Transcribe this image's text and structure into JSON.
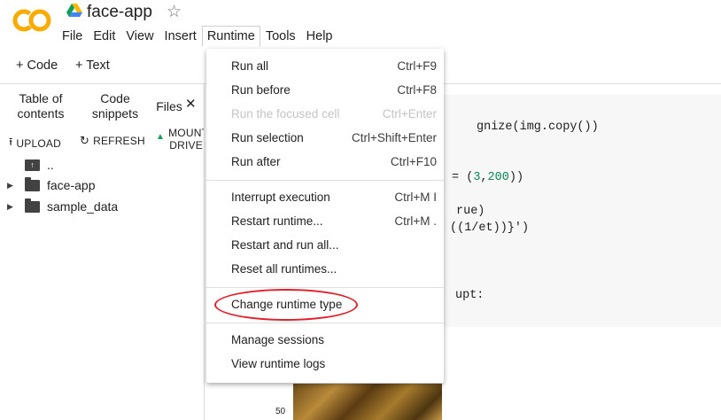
{
  "app": {
    "logo_text": "CO",
    "title": "face-app",
    "brand_color": "#f9ab00"
  },
  "menu": [
    "File",
    "Edit",
    "View",
    "Insert",
    "Runtime",
    "Tools",
    "Help"
  ],
  "toolbar": {
    "code_label": "+ Code",
    "text_label": "+ Text"
  },
  "sidebar": {
    "tabs": [
      "Table of contents",
      "Code snippets",
      "Files"
    ],
    "close_symbol": "✕",
    "actions": {
      "upload": "UPLOAD",
      "refresh": "REFRESH",
      "mount": "MOUNT DRIVE"
    },
    "tree": [
      {
        "name": ".."
      },
      {
        "name": "face-app"
      },
      {
        "name": "sample_data"
      }
    ]
  },
  "code_lines": [
    {
      "text": "gnize(img.copy())"
    },
    {
      "text": "= (3,200))"
    },
    {
      "text": "rue)"
    },
    {
      "text": "((1/et))}')"
    },
    {
      "text": "upt:"
    }
  ],
  "plot": {
    "y_tick": "50"
  },
  "runtime_menu": {
    "items": [
      {
        "label": "Run all",
        "shortcut": "Ctrl+F9",
        "enabled": true
      },
      {
        "label": "Run before",
        "shortcut": "Ctrl+F8",
        "enabled": true
      },
      {
        "label": "Run the focused cell",
        "shortcut": "Ctrl+Enter",
        "enabled": false
      },
      {
        "label": "Run selection",
        "shortcut": "Ctrl+Shift+Enter",
        "enabled": true
      },
      {
        "label": "Run after",
        "shortcut": "Ctrl+F10",
        "enabled": true
      },
      {
        "label": "Interrupt execution",
        "shortcut": "Ctrl+M I",
        "enabled": true
      },
      {
        "label": "Restart runtime...",
        "shortcut": "Ctrl+M .",
        "enabled": true
      },
      {
        "label": "Restart and run all...",
        "shortcut": "",
        "enabled": true
      },
      {
        "label": "Reset all runtimes...",
        "shortcut": "",
        "enabled": true
      },
      {
        "label": "Change runtime type",
        "shortcut": "",
        "enabled": true
      },
      {
        "label": "Manage sessions",
        "shortcut": "",
        "enabled": true
      },
      {
        "label": "View runtime logs",
        "shortcut": "",
        "enabled": true
      }
    ]
  },
  "annotation": {
    "color": "#e0202a"
  }
}
